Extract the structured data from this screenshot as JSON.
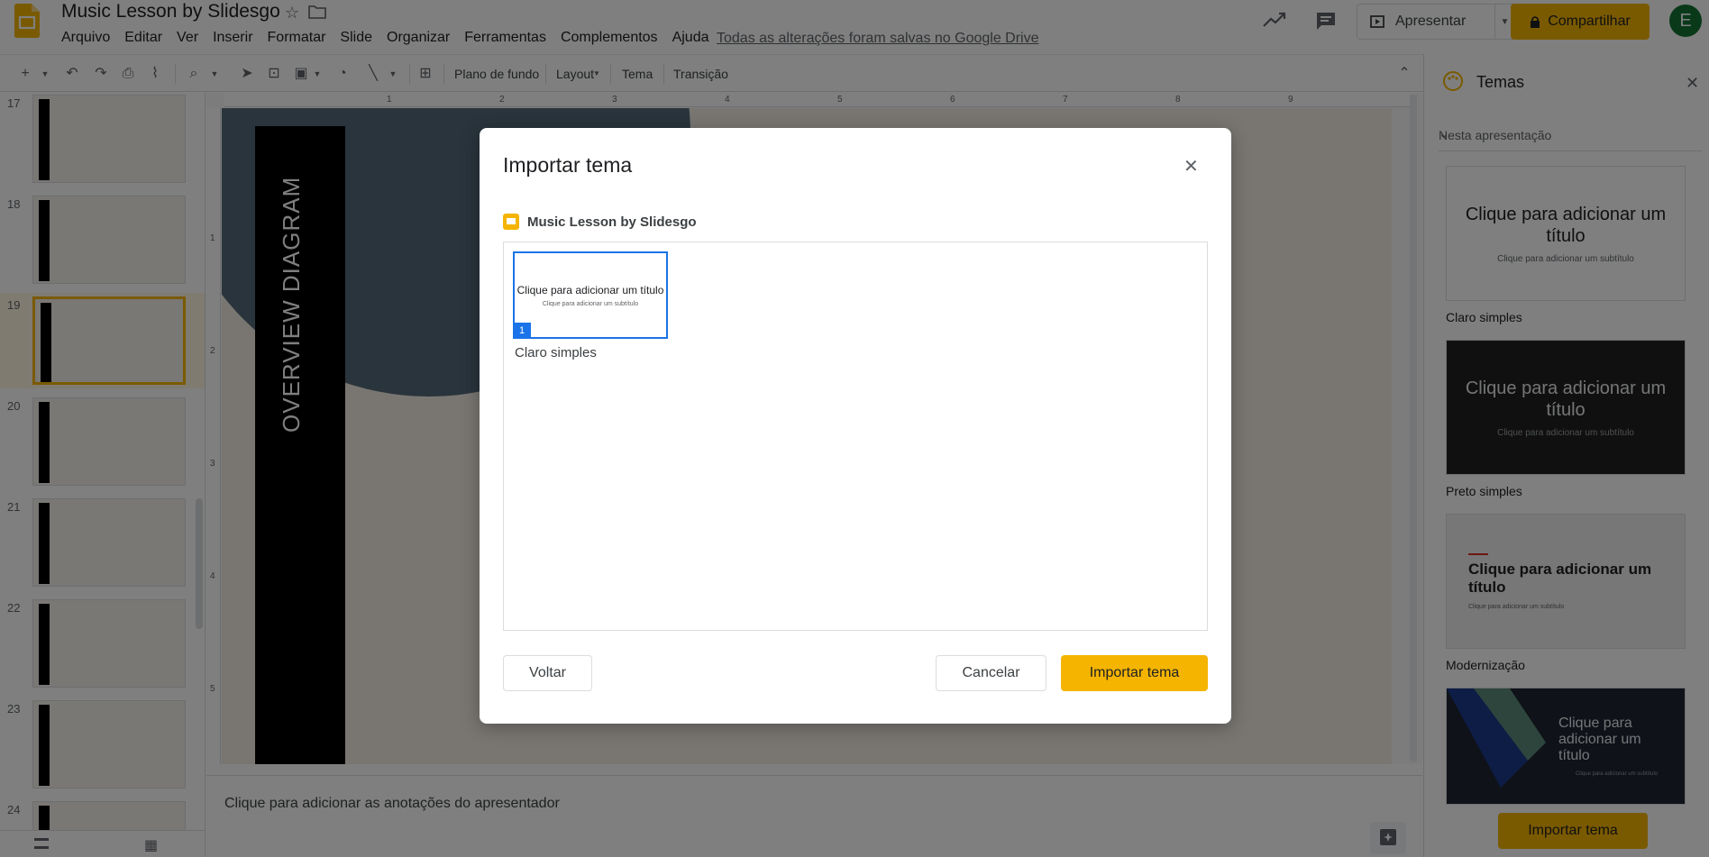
{
  "header": {
    "title": "Music Lesson by Slidesgo",
    "menu": [
      "Arquivo",
      "Editar",
      "Ver",
      "Inserir",
      "Formatar",
      "Slide",
      "Organizar",
      "Ferramentas",
      "Complementos",
      "Ajuda"
    ],
    "save_status": "Todas as alterações foram salvas no Google Drive",
    "present_label": "Apresentar",
    "share_label": "Compartilhar",
    "avatar_letter": "E"
  },
  "toolbar": {
    "background_label": "Plano de fundo",
    "layout_label": "Layout",
    "theme_label": "Tema",
    "transition_label": "Transição"
  },
  "filmstrip": {
    "slide_numbers": [
      "17",
      "18",
      "19",
      "20",
      "21",
      "22",
      "23",
      "24"
    ],
    "selected": "19"
  },
  "canvas": {
    "slide_vertical_text": "OVERVIEW DIAGRAM",
    "ruler_top": [
      "1",
      "2",
      "3",
      "4",
      "5",
      "6",
      "7",
      "8",
      "9"
    ],
    "ruler_left": [
      "1",
      "2",
      "3",
      "4",
      "5"
    ]
  },
  "notes": {
    "placeholder": "Clique para adicionar as anotações do apresentador"
  },
  "themes_panel": {
    "title": "Temas",
    "section": "Nesta apresentação",
    "themes": [
      {
        "name": "Claro simples",
        "title": "Clique para adicionar um título",
        "subtitle": "Clique para adicionar um subtítulo"
      },
      {
        "name": "Preto simples",
        "title": "Clique para adicionar um título",
        "subtitle": "Clique para adicionar um subtítulo"
      },
      {
        "name": "Modernização",
        "title": "Clique para adicionar um título",
        "subtitle": "Clique para adicionar um subtítulo"
      },
      {
        "name": "",
        "title": "Clique para adicionar um título",
        "subtitle": "Clique para adicionar um subtítulo"
      }
    ],
    "import_label": "Importar tema"
  },
  "dialog": {
    "title": "Importar tema",
    "source_name": "Music Lesson by Slidesgo",
    "grid_item": {
      "title": "Clique para adicionar um título",
      "subtitle": "Clique para adicionar um subtítulo",
      "badge": "1",
      "label": "Claro simples"
    },
    "back_label": "Voltar",
    "cancel_label": "Cancelar",
    "import_label": "Importar tema"
  },
  "colors": {
    "accent": "#f4b400",
    "selection_blue": "#1a73e8",
    "slide_bg": "#f3ece4",
    "slide_blob": "#536878"
  }
}
